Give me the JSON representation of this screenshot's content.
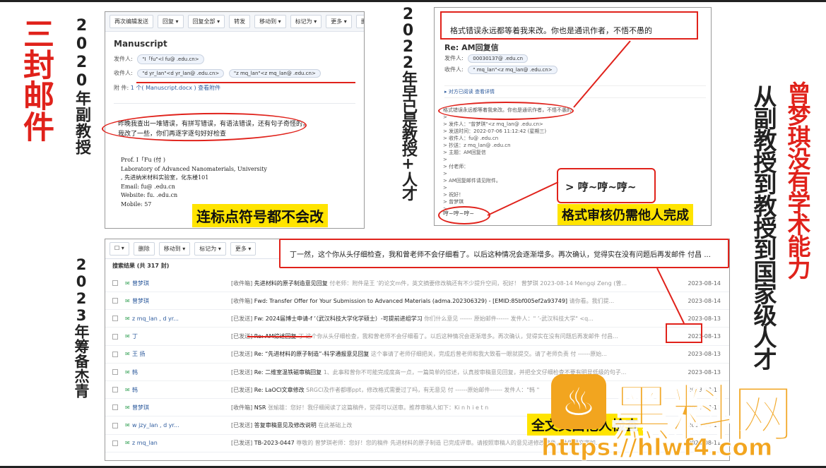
{
  "left_title": "三封邮件",
  "label_2020": "2020年副教授",
  "label_2022": "2022年早已是教授+人才",
  "label_2023": "2023年筹备杰青",
  "right_black": "从副教授到教授到国家级人才",
  "right_red": "曾梦琪没有学术能力",
  "email1": {
    "toolbar": [
      "再次编辑发送",
      "回复 ▾",
      "回复全部 ▾",
      "转发",
      "移动到 ▾",
      "标记为 ▾",
      "更多 ▾",
      "删除"
    ],
    "subject": "Manuscript",
    "from_label": "发件人:",
    "from_chip": "\"I「fu\"<l  fu@     .edu.cn>",
    "to_label": "收件人:",
    "to_chip1": "\"d    yr_lan\"<d    yr_lan@     .edu.cn>",
    "to_chip2": "\"z    mq_lan\"<z    mq_lan@     .edu.cn>",
    "attach_label": "附  件:",
    "attach_text": "1 个( Manuscript.docx ) 查看附件",
    "body": "昨晚我查出一堆错误，有拼写错误，有语法错误，还有句子奇怪的，我改了一些，你们再逐字逐句好好检查",
    "sig": [
      "Prof. I「Fu (付   )",
      "Laboratory of Advanced Nanomaterials,       University",
      ",      先进纳米材料实验室，化东楼101",
      "Email:   fu@     .edu.cn",
      "Website:    fu.      .edu.cn",
      "Mobile:              57"
    ],
    "banner": "连标点符号都不会改"
  },
  "email2": {
    "top_quote": "格式错误永远都等着我来改。你也是通讯作者，不悟不愚的",
    "subject": "Re: AM回复信",
    "from_label": "发件人:",
    "from_chip": "00030137@     .edu.cn",
    "to_label": "收件人:",
    "to_chip": "\"   mq_lan\"<z    mq_lan@     .edu.cn>",
    "collapsed": "▸ 对方已阅读 查看详情",
    "quote_lines": [
      "格式错误永远都等着我来改。你也是通讯作者，不悟不愚的",
      ">",
      "> 发件人：\"曾梦琪\"<z    mq_lan@     .edu.cn>",
      "> 发送时间：2022-07-06 11:12:42 (星期三)",
      "> 收件人：fu@     .edu.cn",
      "> 抄送：z    mq_lan@     .edu.cn",
      "> 主题：AM回复信",
      ">",
      "> 付老师：",
      ">",
      "> AM回复邮件请见附件。",
      ">",
      "> 祝好！",
      "> 曾梦琪",
      ">"
    ],
    "bottom_quote": "哼~哼~哼~",
    "callout_text": "> 哼~哼~哼~",
    "banner": "格式审核仍需他人完成"
  },
  "email3": {
    "toolbar": [
      "☐ ▾",
      "删除",
      "移动到 ▾",
      "标记为 ▾",
      "更多 ▾"
    ],
    "result_label": "搜索结果 (共 317 封)",
    "overlay_quote": "丁一然，这个你从头仔细检查，我和曾老师不会仔细看了。以后这种情况会逐渐增多。再次确认，觉得实在没有问题后再发邮件 付昌 ...",
    "rows": [
      {
        "from": "曾梦琪",
        "folder": "[收件箱]",
        "subject": "先进材料的原子制造意见回复",
        "preview": "付老师：附件是王   ’的论文m件，英文摘要修改稿还有不少提升空间，祝好！ 曾梦琪 2023-08-14 Mengqi Zeng (曾...",
        "date": "2023-08-14"
      },
      {
        "from": "曾梦琪",
        "folder": "[收件箱]",
        "subject": "Fwd: Transfer Offer for Your Submission to Advanced Materials (adma.202306329) - [EMID:85bf005ef2a93749]",
        "preview": "请你看。我们提...",
        "date": "2023-08-14"
      },
      {
        "from": "z    mq_lan , d    yr...",
        "folder": "[已发送]",
        "subject": "Fw: 2024届博士申请-f   ’（武汉科技大学化学硕士）-可提前进组学习",
        "preview": "你们什么意见 ------ 原始邮件------ 发件人：\"   ’-武汉科技大学\" <q...",
        "date": "2023-08-13"
      },
      {
        "from": "丁",
        "folder": "[已发送]",
        "subject": "Re: AM综述回复",
        "preview": "丁      这个你从头仔细检查，我和曾老师不会仔细看了。以后这种情况会逐渐增多。再次确认，觉得实在没有问题后再发邮件 付昌...",
        "date": "2023-08-13"
      },
      {
        "from": "王    扬",
        "folder": "[已发送]",
        "subject": "Re: “先进材料的原子制造”-科学通报意见回复",
        "preview": "这个事请了老师仔细把关，完成后曾老师和我大致看一眼就提交。请了老师负责 付   ------原始...",
        "date": "2023-08-13"
      },
      {
        "from": "韩",
        "folder": "[已发送]",
        "subject": "Re: 二维室温铁磁审稿回复",
        "preview": "1、此事和曾你不可能完成度高一点，一篇简单的综述，认真按审稿意见回复，并把全文仔细检查不要有明显低级的句子...",
        "date": "2023-08-13"
      },
      {
        "from": "韩",
        "folder": "[已发送]",
        "subject": "Re: LaOCl文章修改",
        "preview": "SRGCl及作者都哪ppt，修改格式需要过了吗，有无意见 付   ------原始邮件------ 发件人：\"韩  \"",
        "date": "2023-08-13"
      },
      {
        "from": "曾梦琪",
        "folder": "[收件箱]",
        "subject": "NSR",
        "preview": "张瑜雄：您好！我仔细阅读了这篇稿件，觉得可以送审。推荐审稿人如下：Ki  n  h  i  e  t  n",
        "date": "2023-08-11"
      },
      {
        "from": "w    jzy_lan , d    yr...",
        "folder": "[已发送]",
        "subject": "答复审稿意见及修改说明",
        "preview": "在此基础上改",
        "date": "2023-08-11"
      },
      {
        "from": "z    mq_lan",
        "folder": "[已发送]",
        "subject": "TB-2023-0447",
        "preview": "尊敬的 曾梦琪老师：您好！您的稿件 先进材料的原子制造 已完成评审。请按照审稿人的意见进修改稿件，并使用文字加...",
        "date": "2023-08-11"
      }
    ],
    "banner": "全文交由他人检查"
  },
  "watermark": {
    "brand": "黑料网",
    "url": "https://hlwf4.com"
  },
  "colors": {
    "red": "#e0221b",
    "yellow": "#ffe400",
    "watermark": "#f2a51f"
  }
}
